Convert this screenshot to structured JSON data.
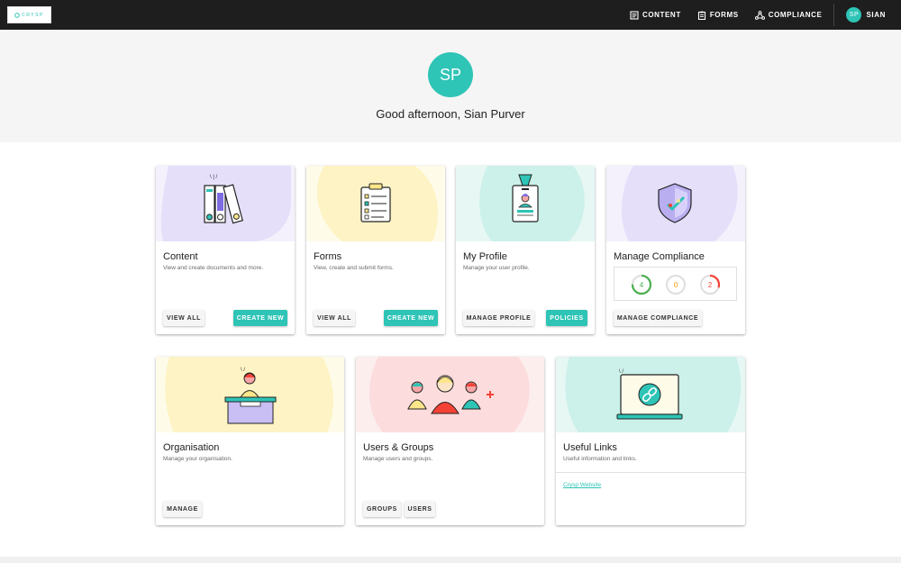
{
  "app": {
    "logo_text": "CRYSP",
    "brand_color": "#2ec4b6"
  },
  "nav": {
    "items": [
      {
        "label": "CONTENT",
        "icon": "document-icon"
      },
      {
        "label": "FORMS",
        "icon": "clipboard-icon"
      },
      {
        "label": "COMPLIANCE",
        "icon": "network-icon"
      }
    ],
    "user": {
      "initials": "SP",
      "label": "SIAN"
    }
  },
  "hero": {
    "initials": "SP",
    "greeting": "Good afternoon, Sian Purver"
  },
  "cards": {
    "content": {
      "title": "Content",
      "desc": "View and create documents and more.",
      "buttons": [
        "VIEW ALL",
        "CREATE NEW"
      ]
    },
    "forms": {
      "title": "Forms",
      "desc": "View, create and submit forms.",
      "buttons": [
        "VIEW ALL",
        "CREATE NEW"
      ]
    },
    "profile": {
      "title": "My Profile",
      "desc": "Manage your user profile.",
      "buttons": [
        "MANAGE PROFILE",
        "POLICIES"
      ]
    },
    "compliance": {
      "title": "Manage Compliance",
      "stats": [
        {
          "value": "4",
          "color": "#4caf50",
          "fraction": 0.75
        },
        {
          "value": "0",
          "color": "#ff9800",
          "fraction": 0.0
        },
        {
          "value": "2",
          "color": "#f44336",
          "fraction": 0.3
        }
      ],
      "buttons": [
        "MANAGE COMPLIANCE"
      ]
    },
    "organisation": {
      "title": "Organisation",
      "desc": "Manage your organisation.",
      "buttons": [
        "MANAGE"
      ]
    },
    "users": {
      "title": "Users & Groups",
      "desc": "Manage users and groups.",
      "buttons": [
        "GROUPS",
        "USERS"
      ]
    },
    "links": {
      "title": "Useful Links",
      "desc": "Useful information and links.",
      "link": "Crysp Website"
    }
  }
}
